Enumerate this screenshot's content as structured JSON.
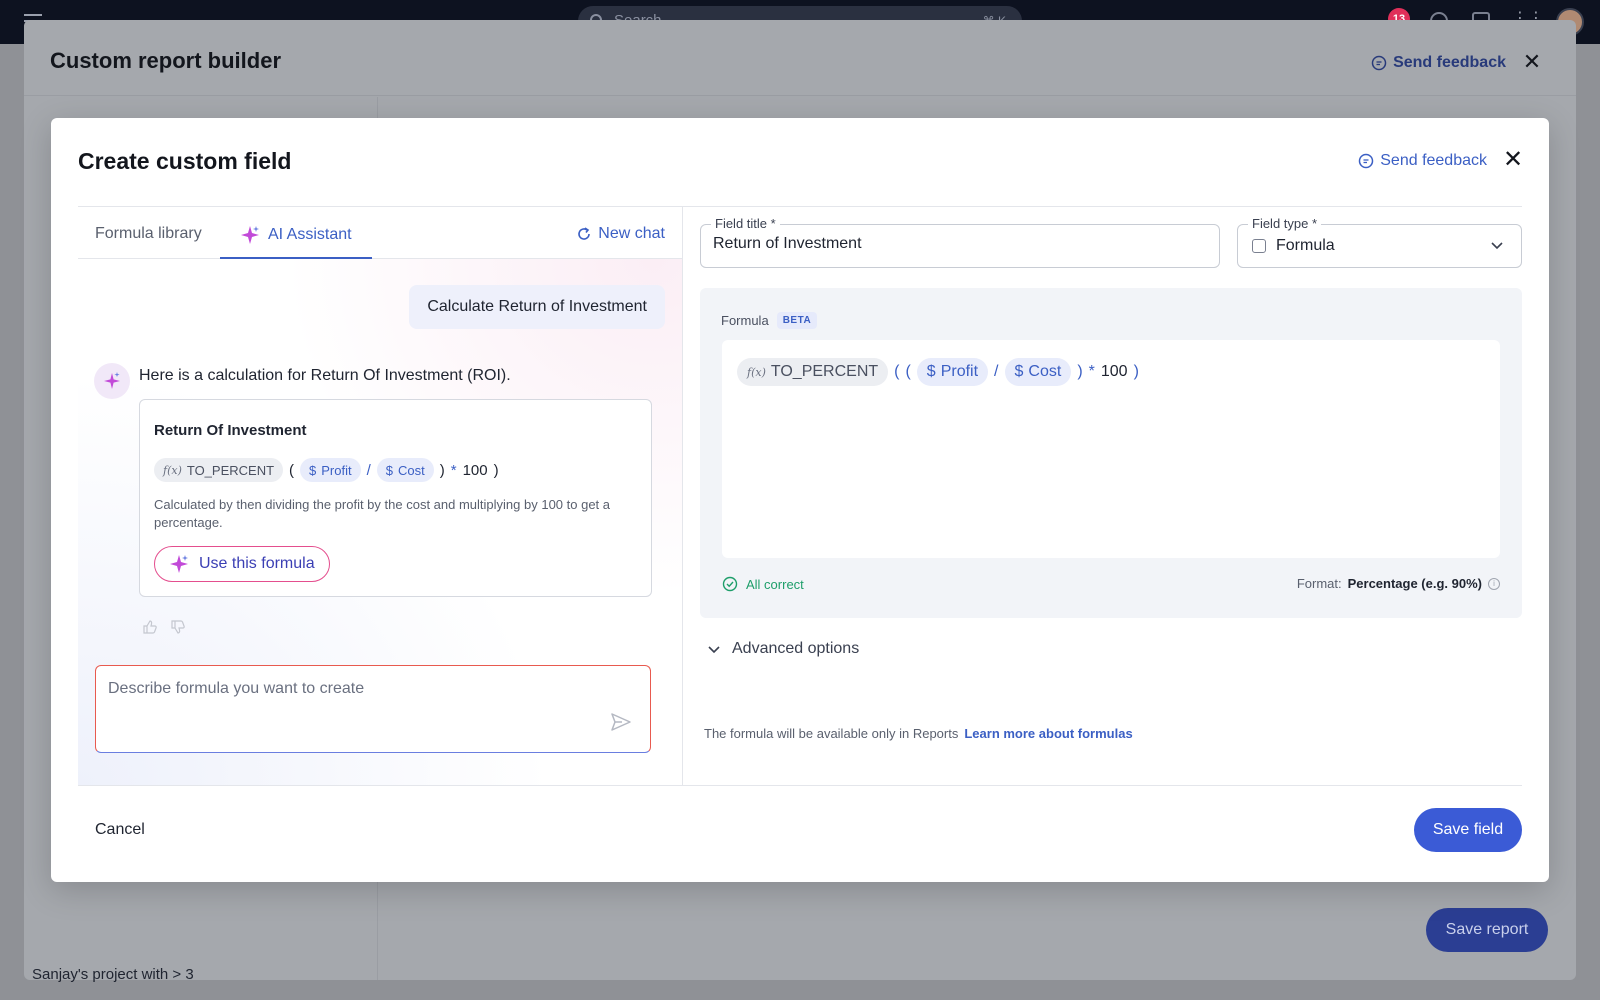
{
  "topbar": {
    "search_placeholder": "Search",
    "search_shortcut": "⌘ K",
    "notification_count": "13"
  },
  "outer": {
    "title": "Custom report builder",
    "feedback_label": "Send feedback",
    "save_report_label": "Save report",
    "background_item": "Sanjay's project with > 3"
  },
  "dialog": {
    "title": "Create custom field",
    "feedback_label": "Send feedback",
    "tabs": [
      {
        "label": "Formula library"
      },
      {
        "label": "AI Assistant"
      }
    ],
    "new_chat_label": "New chat",
    "user_message": "Calculate Return of Investment",
    "ai_message": "Here is a calculation for Return Of Investment (ROI).",
    "suggestion": {
      "title": "Return Of Investment",
      "function": "TO_PERCENT",
      "field_a": "Profit",
      "field_b": "Cost",
      "operator_div": "/",
      "operator_mul": "*",
      "multiplier": "100",
      "paren_open": "(",
      "paren_close": ")",
      "description": "Calculated by then dividing the profit by the cost and multiplying by 100 to get a percentage.",
      "use_label": "Use this formula"
    },
    "chat_input_placeholder": "Describe formula you want to create",
    "field_title_label": "Field title *",
    "field_title_value": "Return of Investment",
    "field_type_label": "Field type *",
    "field_type_value": "Formula",
    "formula_label": "Formula",
    "beta_badge": "BETA",
    "formula": {
      "function": "TO_PERCENT",
      "field_a": "Profit",
      "field_b": "Cost",
      "operator_div": "/",
      "operator_mul": "*",
      "multiplier": "100",
      "paren_open": "(",
      "paren_close": ")"
    },
    "status": "All correct",
    "format_label": "Format:",
    "format_value": "Percentage (e.g. 90%)",
    "advanced_label": "Advanced options",
    "availability_note": "The formula will be available only in Reports",
    "learn_more_label": "Learn more about formulas",
    "cancel_label": "Cancel",
    "save_label": "Save field"
  },
  "colors": {
    "accent": "#3b5fc4",
    "primary_button": "#3b5bd6",
    "success": "#1e9e6a",
    "ai_pink": "#e44e8e"
  },
  "icons": [
    "menu-icon",
    "search-icon",
    "feedback-icon",
    "close-icon",
    "sparkle-icon",
    "refresh-icon",
    "dollar-icon",
    "function-icon",
    "check-circle-icon",
    "info-icon",
    "chevron-down-icon",
    "send-icon",
    "thumbs-up-icon",
    "thumbs-down-icon",
    "formula-type-icon"
  ]
}
